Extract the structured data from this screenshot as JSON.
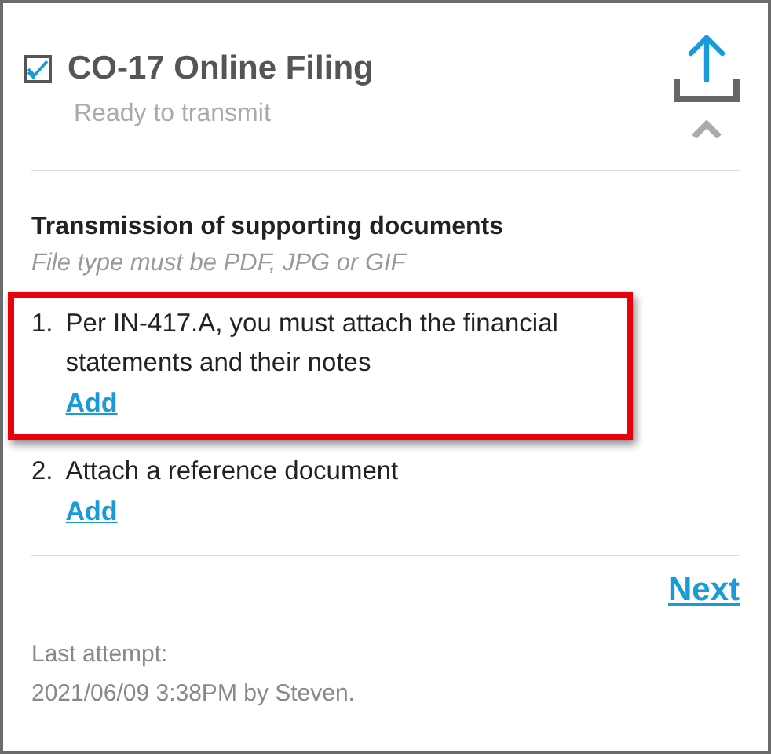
{
  "header": {
    "title": "CO-17 Online Filing",
    "checked": true,
    "status": "Ready to transmit"
  },
  "section": {
    "heading": "Transmission of supporting documents",
    "hint": "File type must be PDF, JPG or GIF"
  },
  "items": [
    {
      "number": "1.",
      "text": "Per IN-417.A, you must attach the financial statements and their notes",
      "link": "Add",
      "highlighted": true
    },
    {
      "number": "2.",
      "text": "Attach a reference document",
      "link": "Add",
      "highlighted": false
    }
  ],
  "next": "Next",
  "footer": {
    "label": "Last attempt:",
    "detail": "2021/06/09 3:38PM by Steven."
  }
}
